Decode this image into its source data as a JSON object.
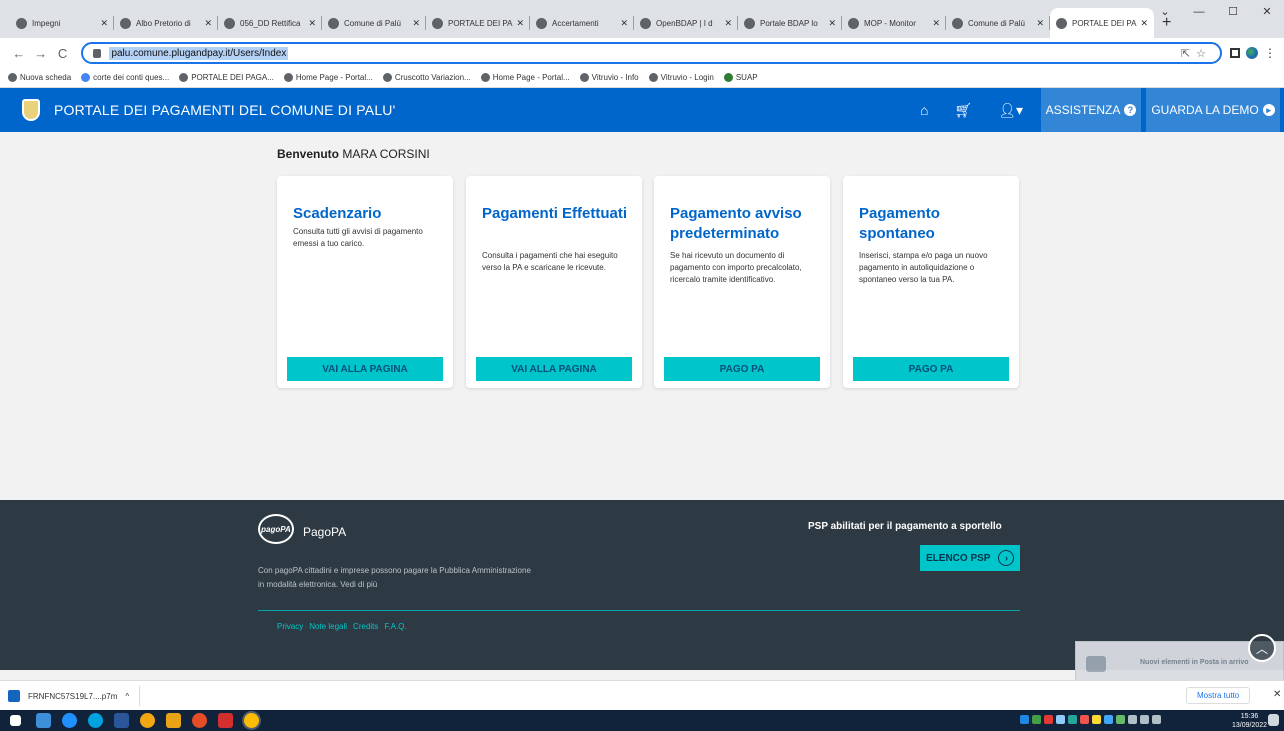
{
  "browser": {
    "tabs": [
      {
        "label": "Impegni",
        "active": false
      },
      {
        "label": "Albo Pretorio di",
        "active": false
      },
      {
        "label": "056_DD Rettifica",
        "active": false
      },
      {
        "label": "Comune di Palù",
        "active": false
      },
      {
        "label": "PORTALE DEI PA",
        "active": false
      },
      {
        "label": "Accertamenti",
        "active": false
      },
      {
        "label": "OpenBDAP | I d",
        "active": false
      },
      {
        "label": "Portale BDAP lo",
        "active": false
      },
      {
        "label": "MOP - Monitor",
        "active": false
      },
      {
        "label": "Comune di Palù",
        "active": false
      },
      {
        "label": "PORTALE DEI PA",
        "active": true
      }
    ],
    "new_tab": "+",
    "url": "palu.comune.plugandpay.it/Users/Index",
    "bookmarks": [
      "Nuova scheda",
      "corte dei conti ques...",
      "PORTALE DEI PAGA...",
      "Home Page - Portal...",
      "Cruscotto Variazion...",
      "Home Page - Portal...",
      "Vitruvio - Info",
      "Vitruvio - Login",
      "SUAP"
    ]
  },
  "header": {
    "title": "PORTALE DEI PAGAMENTI DEL COMUNE DI PALU'",
    "assistenza": "ASSISTENZA",
    "demo": "GUARDA LA DEMO"
  },
  "main": {
    "welcome_prefix": "Benvenuto",
    "user_name": "MARA CORSINI",
    "cards": [
      {
        "title": "Scadenzario",
        "desc": "Consulta tutti gli avvisi di pagamento emessi a tuo carico.",
        "button": "VAI ALLA PAGINA"
      },
      {
        "title": "Pagamenti Effettuati",
        "desc": "Consulta i pagamenti che hai eseguito verso la PA e scaricane le ricevute.",
        "button": "VAI ALLA PAGINA"
      },
      {
        "title": "Pagamento avviso predeterminato",
        "desc": "Se hai ricevuto un documento di pagamento con importo precalcolato, ricercalo tramite identificativo.",
        "button": "PAGO PA"
      },
      {
        "title": "Pagamento spontaneo",
        "desc": "Inserisci, stampa e/o paga un nuovo pagamento in autoliquidazione o spontaneo verso la tua PA.",
        "button": "PAGO PA"
      }
    ]
  },
  "footer": {
    "logo_text": "pagoPA",
    "brand": "PagoPA",
    "description": "Con pagoPA cittadini e imprese possono pagare la Pubblica Amministrazione in modalità elettronica. Vedi di più",
    "psp_title": "PSP abilitati per il pagamento a sportello",
    "psp_button": "ELENCO PSP",
    "links": [
      "Privacy",
      "Note legali",
      "Credits",
      "F.A.Q."
    ]
  },
  "downloads": {
    "file": "FRNFNC57S19L7....p7m",
    "show_all": "Mostra tutto"
  },
  "notification": {
    "text": "Nuovi elementi in Posta in arrivo"
  },
  "taskbar": {
    "time": "15:36",
    "date": "13/09/2022"
  }
}
